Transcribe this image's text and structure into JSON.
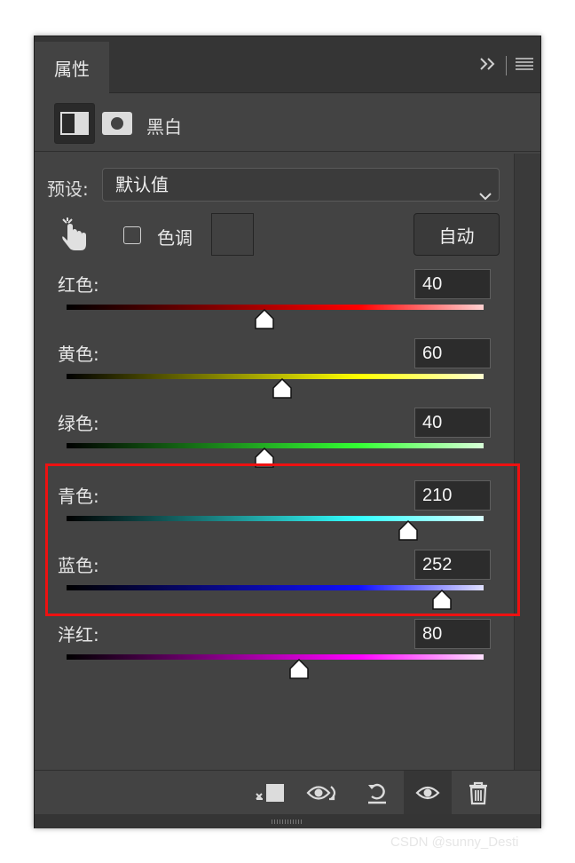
{
  "panel": {
    "tab_title": "属性",
    "adjustment_title": "黑白"
  },
  "preset": {
    "label": "预设:",
    "value": "默认值"
  },
  "tint": {
    "label": "色调",
    "checked": false
  },
  "auto_button": "自动",
  "sliders": [
    {
      "name": "red",
      "label": "红色:",
      "value": "40",
      "fraction": 0.475,
      "gradient": [
        "#000000",
        "#ff0000",
        "#ffd0d0"
      ]
    },
    {
      "name": "yellow",
      "label": "黄色:",
      "value": "60",
      "fraction": 0.517,
      "gradient": [
        "#000000",
        "#ffff00",
        "#ffffd0"
      ]
    },
    {
      "name": "green",
      "label": "绿色:",
      "value": "40",
      "fraction": 0.475,
      "gradient": [
        "#000000",
        "#33ff33",
        "#d8ffd8"
      ]
    },
    {
      "name": "cyan",
      "label": "青色:",
      "value": "210",
      "fraction": 0.82,
      "gradient": [
        "#000000",
        "#33ffff",
        "#d8ffff"
      ]
    },
    {
      "name": "blue",
      "label": "蓝色:",
      "value": "252",
      "fraction": 0.9,
      "gradient": [
        "#000000",
        "#1010ff",
        "#e0e0ff"
      ]
    },
    {
      "name": "magenta",
      "label": "洋红:",
      "value": "80",
      "fraction": 0.557,
      "gradient": [
        "#000000",
        "#ff00ff",
        "#ffe0ff"
      ]
    }
  ],
  "colors": {
    "panel_bg": "#434343",
    "highlight": "#ee1111"
  },
  "footer_icons": [
    "clip-to-layer-icon",
    "view-previous-state-icon",
    "reset-icon",
    "visibility-eye-icon",
    "trash-icon"
  ],
  "watermark": "CSDN @sunny_Desti"
}
